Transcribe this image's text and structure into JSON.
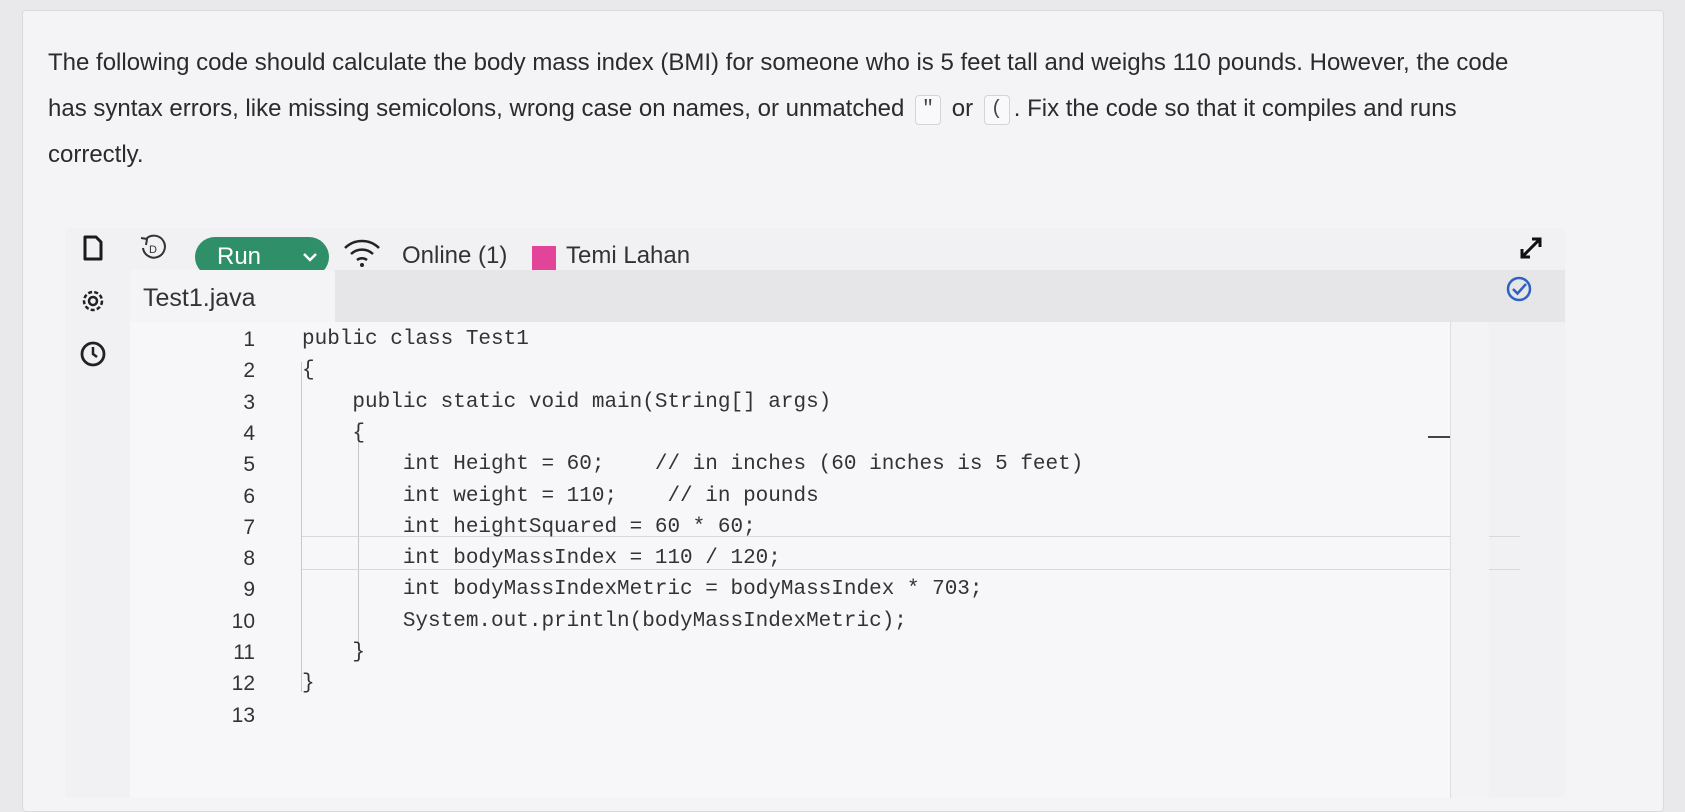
{
  "instructions": {
    "part1": "The following code should calculate the body mass index (BMI) for someone who is 5 feet tall and weighs 110 pounds. However, the code has syntax errors, like missing semicolons, wrong case on names, or unmatched",
    "token_quote": "\"",
    "connector": "or",
    "token_paren": "(",
    "part2": ". Fix the code so that it compiles and runs correctly."
  },
  "toolbar": {
    "run_label": "Run",
    "status": "Online (1)",
    "user_name": "Temi Lahan",
    "presence_color": "#e2449a",
    "run_color": "#2f8f68",
    "icons": [
      "file-icon",
      "reset-icon",
      "chevron-down-icon",
      "wifi-icon",
      "expand-icon",
      "check-circle-icon",
      "settings-icon",
      "history-icon"
    ]
  },
  "editor": {
    "tab_label": "Test1.java",
    "lines": [
      {
        "num": "1",
        "code": "public class Test1"
      },
      {
        "num": "2",
        "code": "{"
      },
      {
        "num": "3",
        "code": "    public static void main(String[] args)"
      },
      {
        "num": "4",
        "code": "    {"
      },
      {
        "num": "5",
        "code": "        int Height = 60;    // in inches (60 inches is 5 feet)"
      },
      {
        "num": "6",
        "code": "        int weight = 110;    // in pounds"
      },
      {
        "num": "7",
        "code": "        int heightSquared = 60 * 60;"
      },
      {
        "num": "8",
        "code": "        int bodyMassIndex = 110 / 120;"
      },
      {
        "num": "9",
        "code": "        int bodyMassIndexMetric = bodyMassIndex * 703;"
      },
      {
        "num": "10",
        "code": "        System.out.println(bodyMassIndexMetric);"
      },
      {
        "num": "11",
        "code": "    }"
      },
      {
        "num": "12",
        "code": "}"
      },
      {
        "num": "13",
        "code": ""
      }
    ]
  }
}
